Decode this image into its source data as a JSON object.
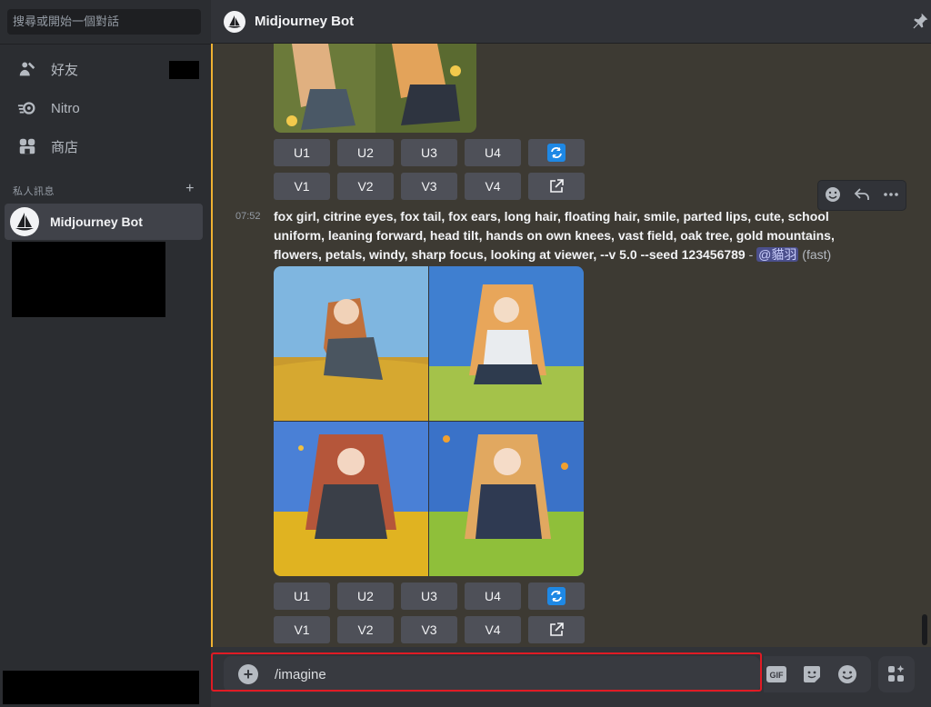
{
  "sidebar": {
    "search_placeholder": "搜尋或開始一個對話",
    "nav": [
      {
        "label": "好友",
        "icon": "friends-icon"
      },
      {
        "label": "Nitro",
        "icon": "nitro-icon"
      },
      {
        "label": "商店",
        "icon": "shop-icon"
      }
    ],
    "dm_header": "私人訊息",
    "dm_add": "+",
    "dm_items": [
      {
        "name": "Midjourney Bot",
        "active": true
      }
    ]
  },
  "header": {
    "title": "Midjourney Bot"
  },
  "chat": {
    "upscale_buttons": [
      "U1",
      "U2",
      "U3",
      "U4"
    ],
    "variation_buttons": [
      "V1",
      "V2",
      "V3",
      "V4"
    ],
    "message": {
      "time": "07:52",
      "prompt": "fox girl, citrine eyes, fox tail, fox ears, long hair, floating hair, smile, parted lips, cute, school uniform, leaning forward, head tilt, hands on own knees, vast field, oak tree, gold mountains, flowers, petals, windy, sharp focus, looking at viewer, --v 5.0 --seed 123456789",
      "separator": " - ",
      "mention": "@貓羽",
      "mode": "(fast)"
    }
  },
  "composer": {
    "value": "/imagine",
    "plus": "+",
    "gif_label": "GIF"
  },
  "colors": {
    "accent_bar": "#f0b232",
    "mention_bg": "#4b4f8c",
    "outline": "#e01b24",
    "refresh_icon": "#1e88e5"
  }
}
